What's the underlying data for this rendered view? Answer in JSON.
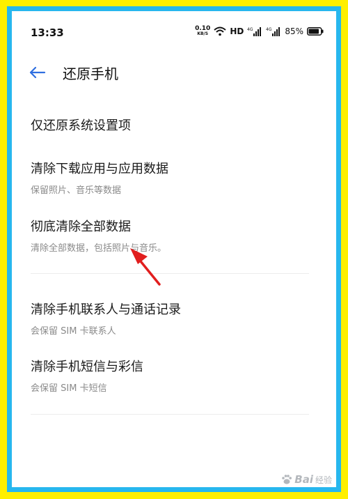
{
  "status_bar": {
    "time": "13:33",
    "net_speed_value": "0.10",
    "net_speed_unit": "KB/S",
    "hd_label": "HD",
    "signal1_label": "4G",
    "signal2_label": "4G",
    "battery_percent": "85%"
  },
  "header": {
    "title": "还原手机"
  },
  "items": [
    {
      "title": "仅还原系统设置项",
      "subtitle": ""
    },
    {
      "title": "清除下载应用与应用数据",
      "subtitle": "保留照片、音乐等数据"
    },
    {
      "title": "彻底清除全部数据",
      "subtitle": "清除全部数据，包括照片与音乐。"
    },
    {
      "title": "清除手机联系人与通话记录",
      "subtitle": "会保留 SIM 卡联系人"
    },
    {
      "title": "清除手机短信与彩信",
      "subtitle": "会保留 SIM 卡短信"
    }
  ],
  "watermark": {
    "brand": "Bai",
    "suffix": "经验"
  },
  "colors": {
    "outer_frame": "#ffef00",
    "inner_frame": "#27b7ee",
    "accent": "#2f6fe0",
    "arrow": "#e11e1e"
  }
}
